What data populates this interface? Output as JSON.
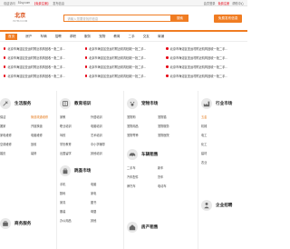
{
  "topbar": {
    "left": [
      "欢迎访问",
      "51sy.com",
      "【免费注册】",
      "发布信息"
    ],
    "right": [
      "会员登录",
      "免费注册",
      "帮助中心"
    ]
  },
  "header": {
    "logo_city": "北京",
    "logo_site": "ISYBJ.COM",
    "search_placeholder": "请输入您要查找的信息",
    "search_button": "搜索",
    "post_button": "免费发布信息"
  },
  "nav": {
    "items": [
      "首页",
      "房产",
      "车辆",
      "招聘",
      "求职",
      "服务",
      "宠物",
      "教育",
      "二手",
      "交友",
      "商铺"
    ]
  },
  "news": [
    "北京市海淀区亚运村附近机构回收一批二手...",
    "北京市海淀区亚运村附近机构回收一批二手...",
    "北京市海淀区亚运村附近机构回收一批二手...",
    "北京市海淀区亚运村附近机构回收一批二手...",
    "北京市海淀区亚运村附近机构回收一批二手...",
    "北京市海淀区亚运村附近机构回收一批二手...",
    "北京市海淀区亚运村附近机构回收一批二手...",
    "北京市海淀区亚运村附近机构回收一批二手...",
    "北京市海淀区亚运村附近机构回收一批二手...",
    "北京市海淀区亚运村附近机构回收一批二手...",
    "北京市海淀区亚运村附近机构回收一批二手...",
    "北京市海淀区亚运村附近机构回收一批二手..."
  ],
  "categories": {
    "life": {
      "title": "生活服务",
      "items": [
        "保洁",
        "管道疏通维修",
        "搬家",
        "开锁换锁",
        "家电维修",
        "电脑维修",
        "空调维修",
        "回收",
        "婚庆",
        "装修"
      ]
    },
    "education": {
      "title": "教育培训",
      "items": [
        "家教",
        "外语培训",
        "职业培训",
        "电脑培训",
        "驾校",
        "艺术培训",
        "学历教育",
        "中小学辅导",
        "出国留学",
        "其他培训"
      ]
    },
    "pets": {
      "title": "宠物市场",
      "items": [
        "宠物狗",
        "宠物猫",
        "宠物用品",
        "宠物服务",
        "宠物寄养",
        "宠物医院"
      ]
    },
    "industry": {
      "title": "行业市场",
      "items": [
        "五金",
        "机械",
        "电工",
        "化工",
        "建材",
        "农业"
      ]
    },
    "auto": {
      "title": "车辆租售",
      "items": [
        "二手车",
        "新车",
        "汽车配件",
        "货车",
        "摩托车",
        "电动车"
      ]
    },
    "secondhand": {
      "title": "跳蚤市场",
      "items": [
        "手机",
        "电脑",
        "数码",
        "家电",
        "家具",
        "图书",
        "服装",
        "母婴",
        "办公用品",
        "其他"
      ]
    },
    "realty": {
      "title": "房产租售",
      "items": [
        "出租",
        "求租",
        "出售",
        "求购",
        "商铺",
        "写字楼"
      ]
    },
    "business": {
      "title": "商务服务",
      "items": [
        "公司注册",
        "财税服务",
        "法律咨询",
        "设计策划",
        "印刷",
        "网站建设"
      ]
    },
    "jobs": {
      "title": "企业招聘",
      "items": [
        "普工",
        "司机",
        "销售",
        "客服",
        "技工",
        "文员"
      ]
    }
  }
}
